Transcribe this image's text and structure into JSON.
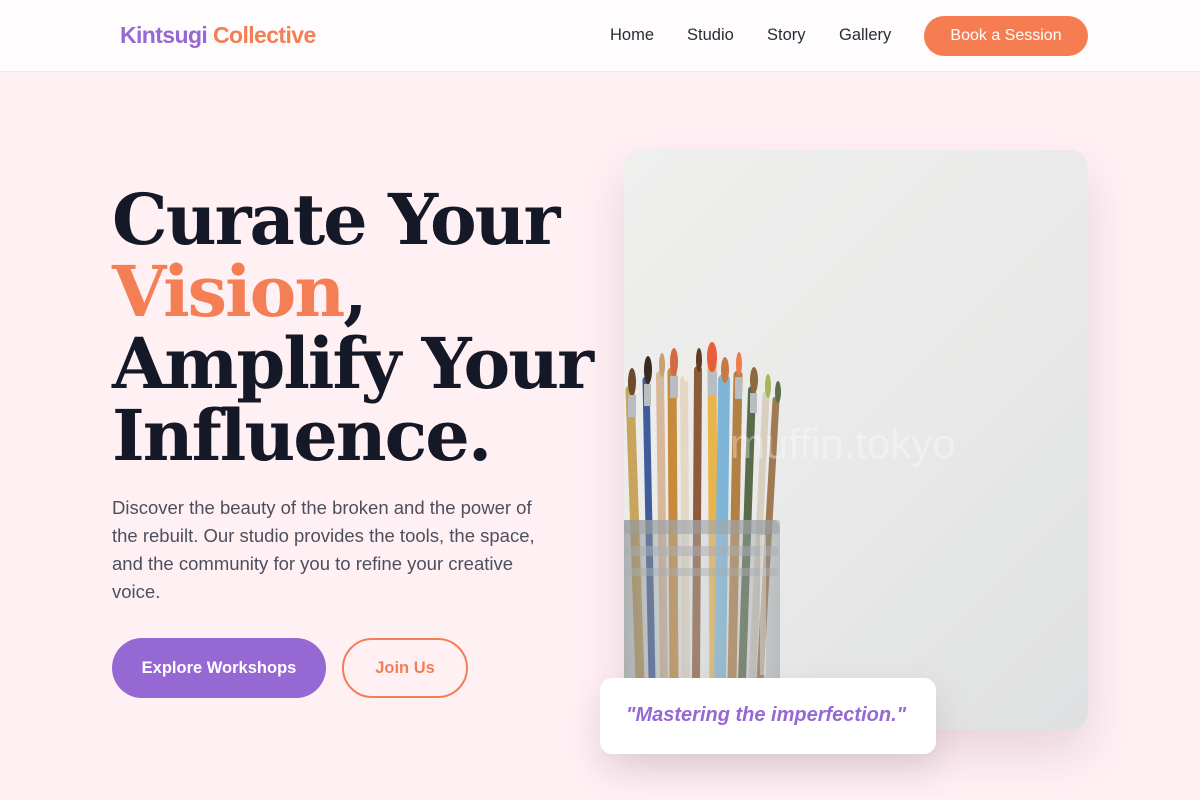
{
  "brand": {
    "name_part1": "Kintsugi",
    "name_part2": "Collective",
    "color_primary": "#9668d3",
    "color_accent": "#f47f55"
  },
  "nav": {
    "items": [
      "Home",
      "Studio",
      "Story",
      "Gallery"
    ],
    "cta": "Book a Session"
  },
  "hero": {
    "title_line1": "Curate Your",
    "title_accent": "Vision",
    "title_comma": ",",
    "title_line3": "Amplify Your",
    "title_line4": "Influence.",
    "description": "Discover the beauty of the broken and the power of the rebuilt. Our studio provides the tools, the space, and the community for you to refine your creative voice.",
    "primary_button": "Explore Workshops",
    "secondary_button": "Join Us"
  },
  "image": {
    "subject": "paint-brushes-in-jar",
    "watermark": "muffin.tokyo"
  },
  "quote": {
    "text": "\"Mastering the imperfection.\""
  }
}
